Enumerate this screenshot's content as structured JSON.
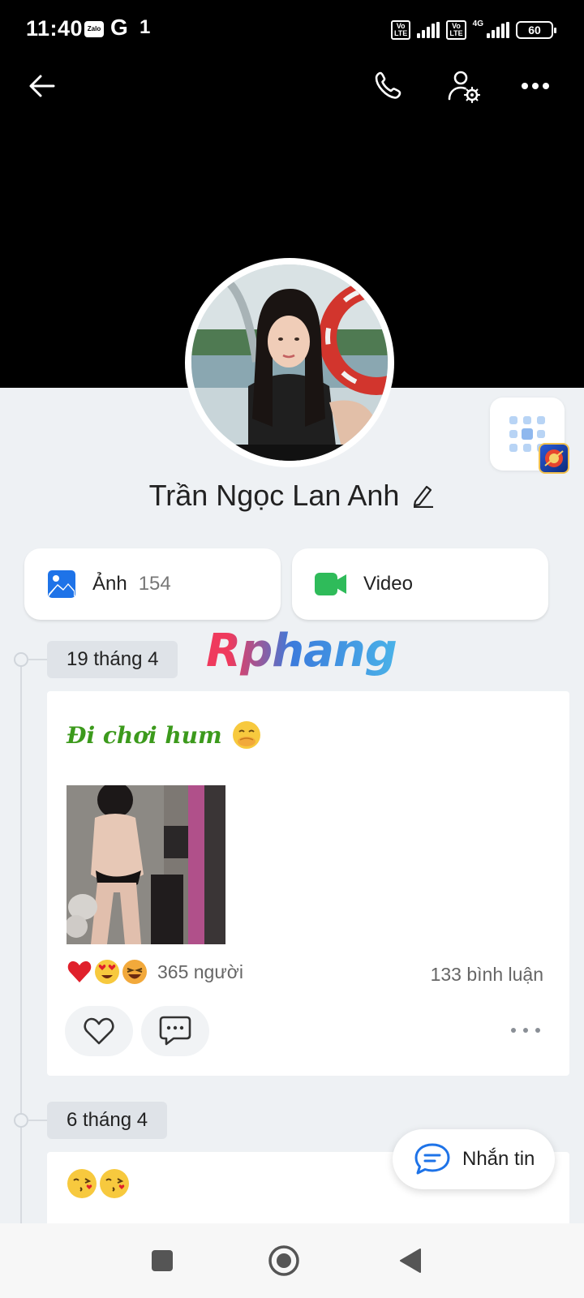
{
  "status_bar": {
    "time": "11:40",
    "zalo_label": "Zalo",
    "g_label": "G",
    "notif_count": "1",
    "volte_label": "Vo LTE",
    "network_label": "4G",
    "battery": "60"
  },
  "profile": {
    "name": "Trần Ngọc Lan Anh"
  },
  "media": {
    "photos_label": "Ảnh",
    "photos_count": "154",
    "video_label": "Video"
  },
  "watermark": "Rphang",
  "posts": [
    {
      "date": "19 tháng 4",
      "text": "Đi chơi hum",
      "reaction_count": "365 người",
      "comment_count": "133 bình luận"
    },
    {
      "date": "6 tháng 4"
    }
  ],
  "message_button": {
    "label": "Nhắn tin"
  },
  "colors": {
    "accent_blue": "#1e73e8",
    "video_green": "#2fbb5a",
    "post_text_green": "#3c9a1c",
    "cover_bg": "#000000",
    "page_bg": "#eef1f4"
  },
  "icons": [
    "back-arrow-icon",
    "phone-icon",
    "user-settings-icon",
    "more-horizontal-icon",
    "qr-icon",
    "image-icon",
    "video-camera-icon",
    "heart-icon",
    "comment-icon",
    "message-icon",
    "square-icon",
    "circle-icon",
    "back-triangle-icon"
  ]
}
